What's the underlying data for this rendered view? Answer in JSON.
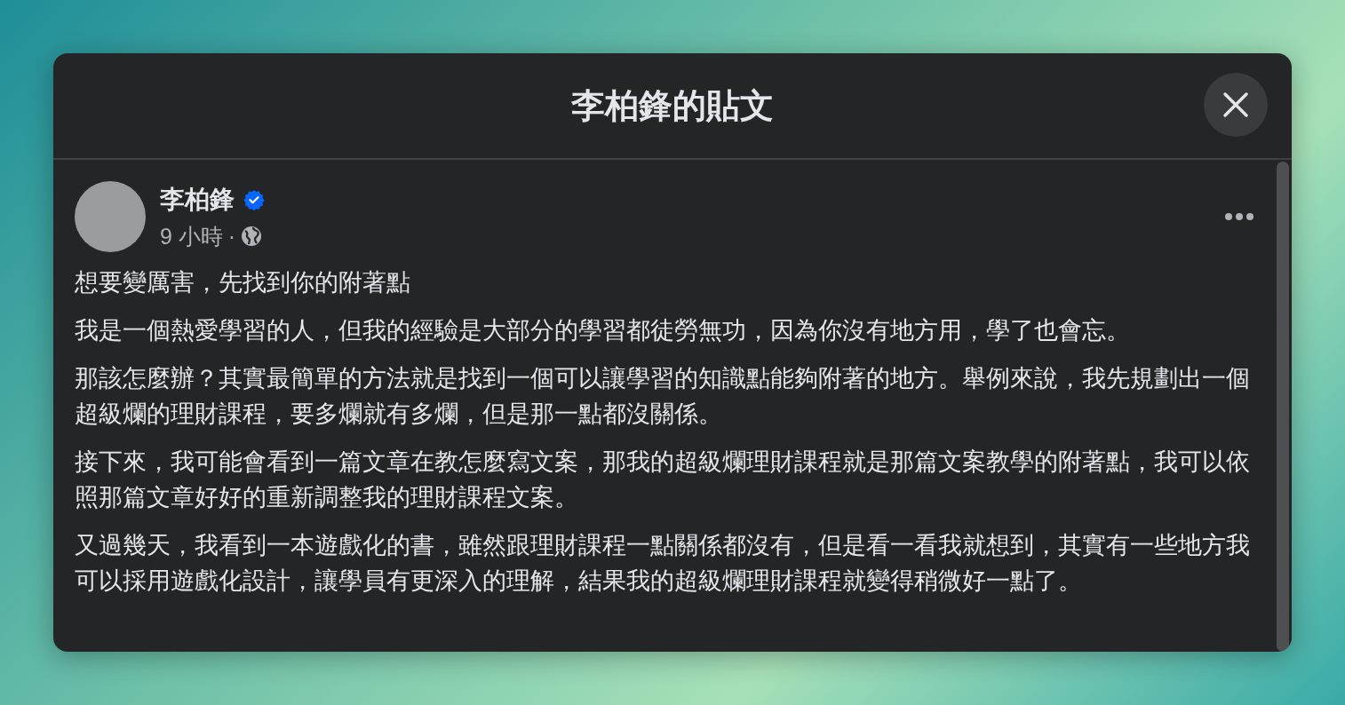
{
  "dialog": {
    "title": "李柏鋒的貼文"
  },
  "post": {
    "author": "李柏鋒",
    "verified": true,
    "time": "9 小時",
    "separator": "·",
    "paragraphs": [
      "想要變厲害，先找到你的附著點",
      "我是一個熱愛學習的人，但我的經驗是大部分的學習都徒勞無功，因為你沒有地方用，學了也會忘。",
      "那該怎麼辦？其實最簡單的方法就是找到一個可以讓學習的知識點能夠附著的地方。舉例來說，我先規劃出一個超級爛的理財課程，要多爛就有多爛，但是那一點都沒關係。",
      "接下來，我可能會看到一篇文章在教怎麼寫文案，那我的超級爛理財課程就是那篇文案教學的附著點，我可以依照那篇文章好好的重新調整我的理財課程文案。",
      "又過幾天，我看到一本遊戲化的書，雖然跟理財課程一點關係都沒有，但是看一看我就想到，其實有一些地方我可以採用遊戲化設計，讓學員有更深入的理解，結果我的超級爛理財課程就變得稍微好一點了。"
    ]
  }
}
